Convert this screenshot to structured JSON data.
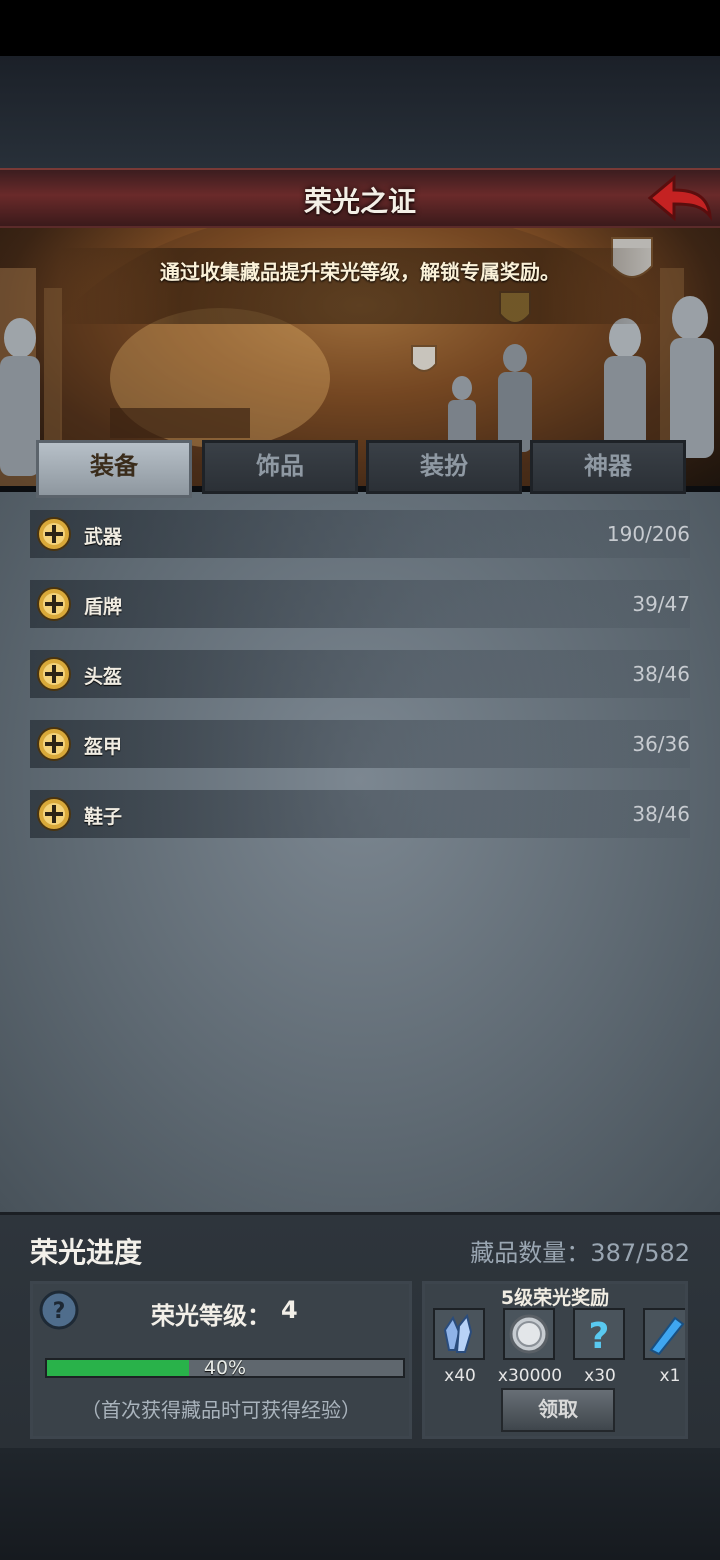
{
  "header": {
    "title": "荣光之证"
  },
  "banner": {
    "caption": "通过收集藏品提升荣光等级，解锁专属奖励。"
  },
  "tabs": [
    {
      "label": "装备",
      "active": true
    },
    {
      "label": "饰品",
      "active": false
    },
    {
      "label": "装扮",
      "active": false
    },
    {
      "label": "神器",
      "active": false
    }
  ],
  "categories": [
    {
      "label": "武器",
      "count": "190/206"
    },
    {
      "label": "盾牌",
      "count": "39/47"
    },
    {
      "label": "头盔",
      "count": "38/46"
    },
    {
      "label": "盔甲",
      "count": "36/36"
    },
    {
      "label": "鞋子",
      "count": "38/46"
    }
  ],
  "progress": {
    "title": "荣光进度",
    "collection_label": "藏品数量：387/582",
    "level_label": "荣光等级：",
    "level_value": "4",
    "percent_text": "40%",
    "percent": 0.4,
    "hint": "（首次获得藏品时可获得经验）"
  },
  "reward": {
    "title": "5级荣光奖励",
    "items": [
      {
        "icon": "crystal-cluster-icon",
        "qty": "x40"
      },
      {
        "icon": "silver-coin-icon",
        "qty": "x30000"
      },
      {
        "icon": "mystery-question-icon",
        "qty": "x30"
      },
      {
        "icon": "blue-shard-icon",
        "qty": "x1"
      }
    ],
    "claim_label": "领取"
  },
  "colors": {
    "accent_gold": "#e2b23a",
    "progress_green": "#29b24a",
    "header_red": "#6a2a2a"
  }
}
